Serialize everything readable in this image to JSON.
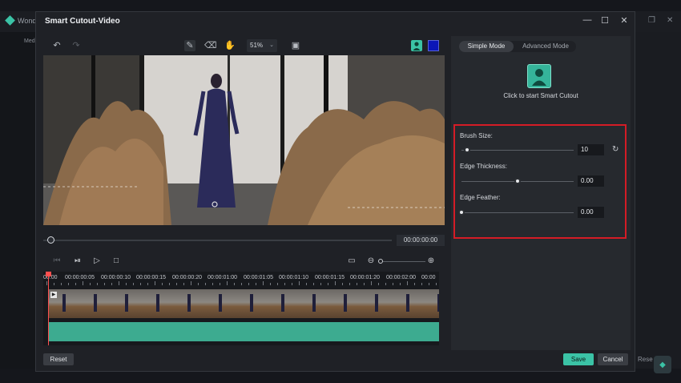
{
  "background_app": {
    "title": "Wonde",
    "media_label": "Med",
    "reset_label": "Rese"
  },
  "dialog": {
    "title": "Smart Cutout-Video",
    "controls": [
      "minimize-icon",
      "maximize-icon",
      "close-icon"
    ]
  },
  "toolbar": {
    "zoom_value": "51%",
    "colors": {
      "accent": "#3bc3a6",
      "overlay_color": "#0b16b8"
    }
  },
  "player": {
    "timecode": "00:00:00:00"
  },
  "timeline": {
    "ruler_labels": [
      "00:00",
      "00:00:00:05",
      "00:00:00:10",
      "00:00:00:15",
      "00:00:00:20",
      "00:00:01:00",
      "00:00:01:05",
      "00:00:01:10",
      "00:00:01:15",
      "00:00:01:20",
      "00:00:02:00",
      "00:00"
    ]
  },
  "right_panel": {
    "tabs": [
      "Simple Mode",
      "Advanced Mode"
    ],
    "active_tab": "Simple Mode",
    "cutout_label": "Click to start Smart Cutout",
    "brush_size": {
      "label": "Brush Size:",
      "value": "10",
      "level": 0.05
    },
    "edge_thickness": {
      "label": "Edge Thickness:",
      "value": "0.00",
      "level": 0.5
    },
    "edge_feather": {
      "label": "Edge Feather:",
      "value": "0.00",
      "level": 0.0
    }
  },
  "footer": {
    "reset": "Reset",
    "save": "Save",
    "cancel": "Cancel"
  }
}
